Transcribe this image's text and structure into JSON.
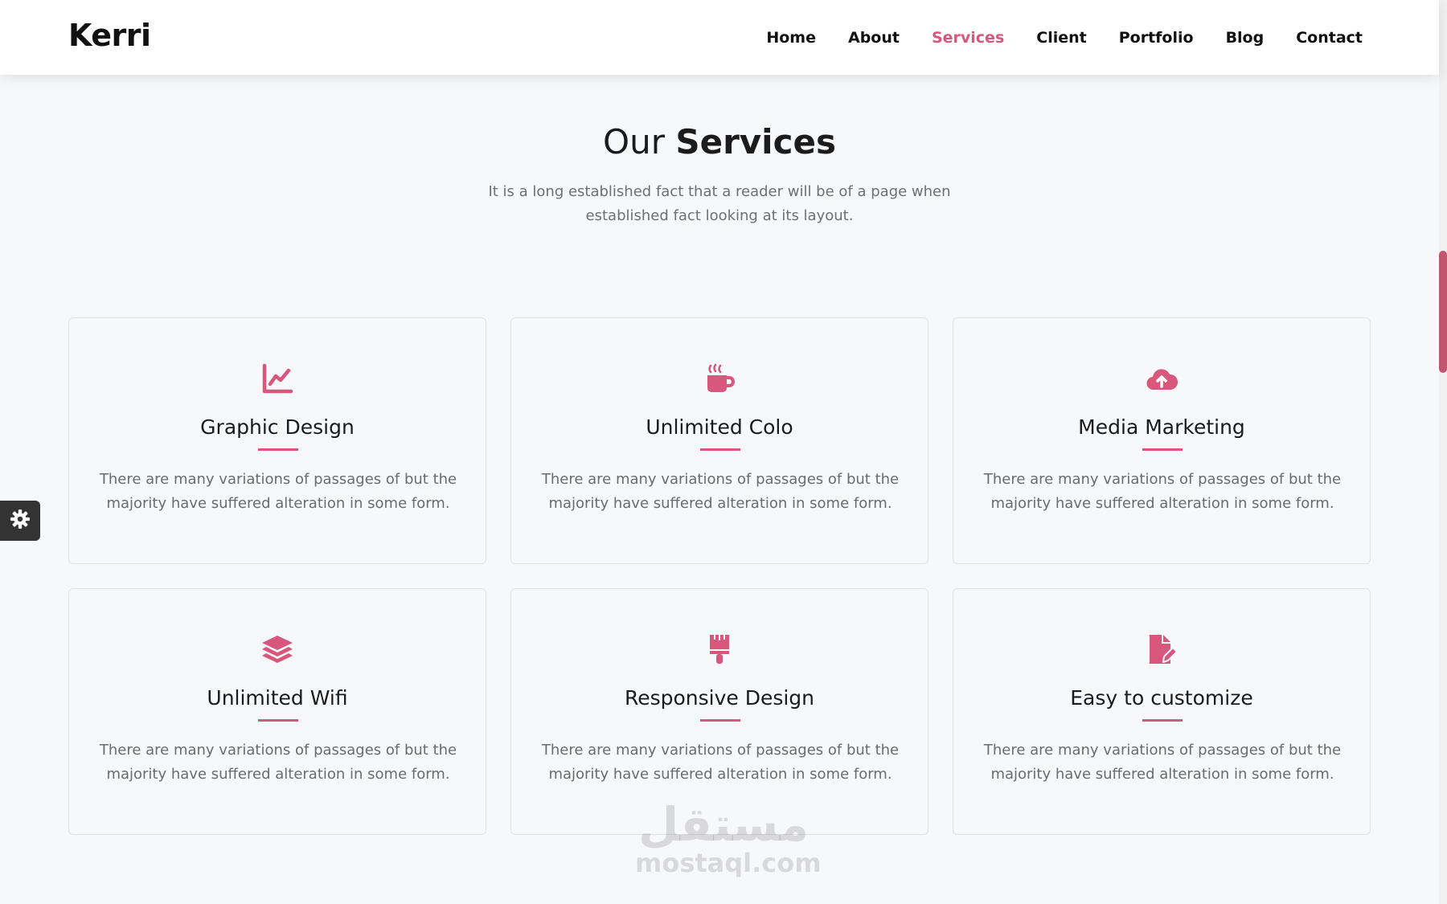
{
  "header": {
    "logo": "Kerri",
    "nav": [
      "Home",
      "About",
      "Services",
      "Client",
      "Portfolio",
      "Blog",
      "Contact"
    ],
    "active_nav": "Services"
  },
  "section": {
    "title_light": "Our",
    "title_bold": "Services",
    "subtitle": "It is a long established fact that a reader will be of a page when established fact looking at its layout."
  },
  "services": [
    {
      "icon": "chart-line-icon",
      "title": "Graphic Design",
      "desc": "There are many variations of passages of but the majority have suffered alteration in some form."
    },
    {
      "icon": "coffee-icon",
      "title": "Unlimited Colo",
      "desc": "There are many variations of passages of but the majority have suffered alteration in some form."
    },
    {
      "icon": "cloud-upload-icon",
      "title": "Media Marketing",
      "desc": "There are many variations of passages of but the majority have suffered alteration in some form."
    },
    {
      "icon": "layers-icon",
      "title": "Unlimited Wifi",
      "desc": "There are many variations of passages of but the majority have suffered alteration in some form."
    },
    {
      "icon": "paint-brush-icon",
      "title": "Responsive Design",
      "desc": "There are many variations of passages of but the majority have suffered alteration in some form."
    },
    {
      "icon": "file-edit-icon",
      "title": "Easy to customize",
      "desc": "There are many variations of passages of but the majority have suffered alteration in some form."
    }
  ],
  "watermark": {
    "arabic": "مستقل",
    "latin": "mostaql.com"
  },
  "colors": {
    "accent": "#d8577c",
    "text": "#1b1b1b",
    "muted": "#6b6b6b",
    "background": "#f7f8fa"
  }
}
